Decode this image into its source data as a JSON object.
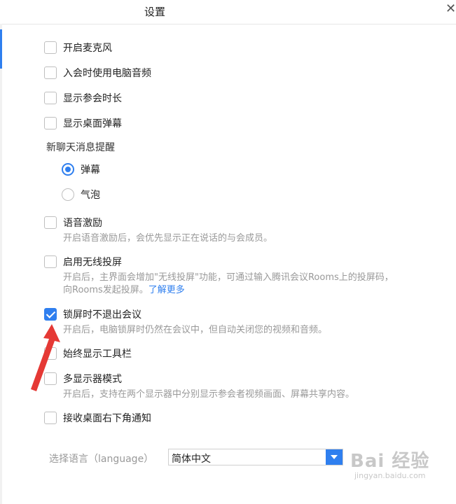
{
  "window": {
    "title": "设置",
    "close_label": "✕"
  },
  "options": {
    "mic": {
      "label": "开启麦克风",
      "checked": false
    },
    "computer_audio": {
      "label": "入会时使用电脑音频",
      "checked": false
    },
    "show_duration": {
      "label": "显示参会时长",
      "checked": false
    },
    "desktop_danmaku": {
      "label": "显示桌面弹幕",
      "checked": false
    },
    "voice_excitation": {
      "label": "语音激励",
      "checked": false,
      "desc": "开启语音激励后，会优先显示正在说话的与会成员。"
    },
    "wireless_screen": {
      "label": "启用无线投屏",
      "checked": false,
      "desc": "开启后，主界面会增加\"无线投屏\"功能，可通过输入腾讯会议Rooms上的投屏码，向Rooms发起投屏。",
      "link": "了解更多"
    },
    "lock_screen": {
      "label": "锁屏时不退出会议",
      "checked": true,
      "desc": "开启后，电脑锁屏时仍然在会议中，但自动关闭您的视频和音频。"
    },
    "toolbar": {
      "label": "始终显示工具栏",
      "checked": false
    },
    "multi_display": {
      "label": "多显示器模式",
      "checked": false,
      "desc": "开启后，支持在两个显示器中分别显示参会者视频画面、屏幕共享内容。"
    },
    "desktop_notify": {
      "label": "接收桌面右下角通知",
      "checked": false
    }
  },
  "chat_reminder": {
    "section_label": "新聊天消息提醒",
    "options": [
      {
        "label": "弹幕",
        "selected": true
      },
      {
        "label": "气泡",
        "selected": false
      }
    ]
  },
  "language": {
    "label": "选择语言（language）",
    "value": "简体中文"
  },
  "watermark": {
    "main": "Bai 经验",
    "sub": "jingyan.baidu.com"
  },
  "colors": {
    "accent": "#2f7fef",
    "annotation_arrow": "#e53935",
    "muted_text": "#999999"
  },
  "icons": {
    "close": "close-icon",
    "checkbox_checked": "check-icon",
    "dropdown": "chevron-down-icon"
  }
}
